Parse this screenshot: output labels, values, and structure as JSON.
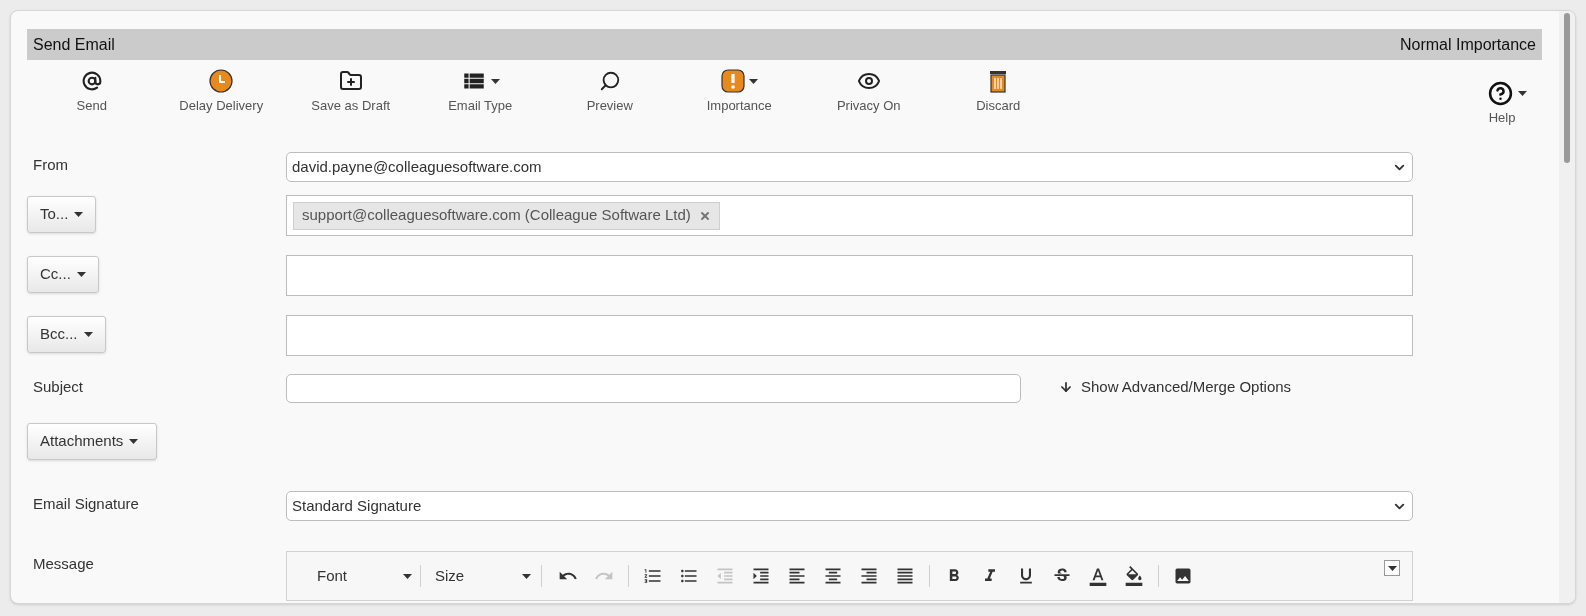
{
  "header": {
    "title": "Send Email",
    "importance": "Normal Importance"
  },
  "toolbar": [
    {
      "kind": "send",
      "label": "Send",
      "caret": false
    },
    {
      "kind": "delay",
      "label": "Delay Delivery",
      "caret": false
    },
    {
      "kind": "draft",
      "label": "Save as Draft",
      "caret": false
    },
    {
      "kind": "type",
      "label": "Email Type",
      "caret": true
    },
    {
      "kind": "preview",
      "label": "Preview",
      "caret": false
    },
    {
      "kind": "importance",
      "label": "Importance",
      "caret": true
    },
    {
      "kind": "privacy",
      "label": "Privacy On",
      "caret": false
    },
    {
      "kind": "discard",
      "label": "Discard",
      "caret": false
    }
  ],
  "help": {
    "label": "Help",
    "caret": true
  },
  "form": {
    "from": {
      "label": "From",
      "value": "david.payne@colleaguesoftware.com"
    },
    "to": {
      "button": "To...",
      "recipients": [
        "support@colleaguesoftware.com (Colleague Software Ltd)"
      ]
    },
    "cc": {
      "button": "Cc..."
    },
    "bcc": {
      "button": "Bcc..."
    },
    "subject": {
      "label": "Subject",
      "link": "Show Advanced/Merge Options"
    },
    "attachments": {
      "button": "Attachments"
    },
    "signature": {
      "label": "Email Signature",
      "value": "Standard Signature"
    },
    "message": {
      "label": "Message"
    }
  },
  "editor": {
    "font": "Font",
    "size": "Size",
    "tools": [
      {
        "kind": "undo",
        "disabled": false
      },
      {
        "kind": "redo",
        "disabled": true
      },
      {
        "kind": "sep"
      },
      {
        "kind": "ol",
        "disabled": false
      },
      {
        "kind": "ul",
        "disabled": false
      },
      {
        "kind": "outdent",
        "disabled": true
      },
      {
        "kind": "indent",
        "disabled": false
      },
      {
        "kind": "left",
        "disabled": false
      },
      {
        "kind": "center",
        "disabled": false
      },
      {
        "kind": "right",
        "disabled": false
      },
      {
        "kind": "justify",
        "disabled": false
      },
      {
        "kind": "sep"
      },
      {
        "kind": "bold",
        "disabled": false
      },
      {
        "kind": "italic",
        "disabled": false
      },
      {
        "kind": "underline",
        "disabled": false
      },
      {
        "kind": "strike",
        "disabled": false
      },
      {
        "kind": "color",
        "disabled": false
      },
      {
        "kind": "bgcolor",
        "disabled": false
      },
      {
        "kind": "sep"
      },
      {
        "kind": "image",
        "disabled": false
      }
    ]
  }
}
